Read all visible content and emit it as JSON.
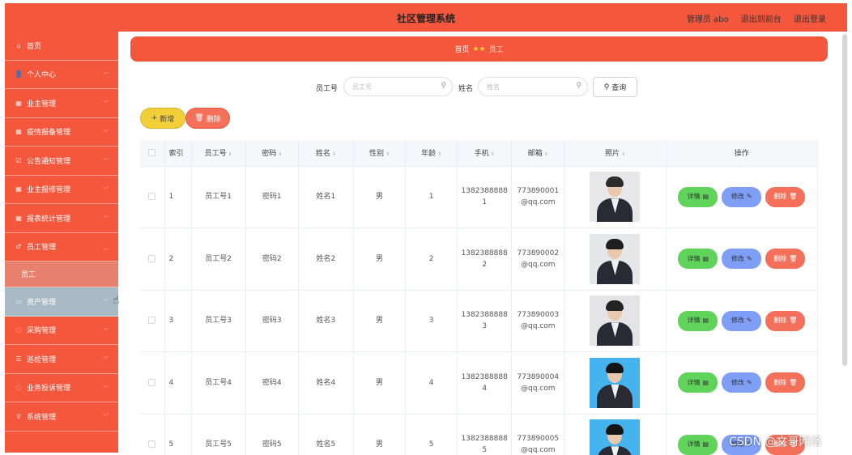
{
  "header": {
    "title": "社区管理系统",
    "user": "管理员 abo",
    "back_link": "退出到前台",
    "logout_link": "退出登录"
  },
  "sidebar": {
    "items": [
      {
        "label": "首页",
        "icon": "⌂",
        "icon_name": "home-icon",
        "has_chevron": false
      },
      {
        "label": "个人中心",
        "icon": "👤",
        "icon_name": "user-icon",
        "has_chevron": true
      },
      {
        "label": "业主管理",
        "icon": "▦",
        "icon_name": "grid-icon",
        "has_chevron": true
      },
      {
        "label": "疫情报备管理",
        "icon": "▦",
        "icon_name": "grid-icon",
        "has_chevron": true
      },
      {
        "label": "公告通知管理",
        "icon": "☑",
        "icon_name": "checkbox-icon",
        "has_chevron": true
      },
      {
        "label": "业主报修管理",
        "icon": "▦",
        "icon_name": "grid-icon",
        "has_chevron": true
      },
      {
        "label": "报表统计管理",
        "icon": "▦",
        "icon_name": "grid-icon",
        "has_chevron": true
      },
      {
        "label": "员工管理",
        "icon": "♂",
        "icon_name": "staff-icon",
        "has_chevron": true,
        "expanded": true
      },
      {
        "label": "员工",
        "icon": "",
        "icon_name": "",
        "has_chevron": false,
        "submenu": true
      },
      {
        "label": "资产管理",
        "icon": "▭",
        "icon_name": "monitor-icon",
        "has_chevron": true,
        "hover": true
      },
      {
        "label": "采购管理",
        "icon": "◌",
        "icon_name": "circle-icon",
        "has_chevron": true
      },
      {
        "label": "巡检管理",
        "icon": "☰",
        "icon_name": "list-icon",
        "has_chevron": true
      },
      {
        "label": "业务投诉管理",
        "icon": "◌",
        "icon_name": "circle-icon",
        "has_chevron": true
      },
      {
        "label": "系统管理",
        "icon": "⚲",
        "icon_name": "pin-icon",
        "has_chevron": true
      }
    ]
  },
  "breadcrumb": {
    "home": "首页",
    "current": "员工"
  },
  "search": {
    "employee_no_label": "员工号",
    "employee_no_placeholder": "员工号",
    "name_label": "姓名",
    "name_placeholder": "姓名",
    "query_button": "查询"
  },
  "actions": {
    "add": "新增",
    "delete": "删除"
  },
  "table": {
    "columns": [
      "索引",
      "员工号",
      "密码",
      "姓名",
      "性别",
      "年龄",
      "手机",
      "邮箱",
      "照片",
      "操作"
    ],
    "row_buttons": {
      "detail": "详情",
      "edit": "修改",
      "remove": "删除"
    },
    "rows": [
      {
        "index": "1",
        "emp_no": "员工号1",
        "password": "密码1",
        "name": "姓名1",
        "gender": "男",
        "age": "1",
        "phone_1": "1382388888",
        "phone_2": "1",
        "email_1": "773890001",
        "email_2": "@qq.com",
        "photo_bg": "#e8e8ea",
        "photo_hair": "#2b2b2b"
      },
      {
        "index": "2",
        "emp_no": "员工号2",
        "password": "密码2",
        "name": "姓名2",
        "gender": "男",
        "age": "2",
        "phone_1": "1382388888",
        "phone_2": "2",
        "email_1": "773890002",
        "email_2": "@qq.com",
        "photo_bg": "#e6e7e9",
        "photo_hair": "#1e1e1e"
      },
      {
        "index": "3",
        "emp_no": "员工号3",
        "password": "密码3",
        "name": "姓名3",
        "gender": "男",
        "age": "3",
        "phone_1": "1382388888",
        "phone_2": "3",
        "email_1": "773890003",
        "email_2": "@qq.com",
        "photo_bg": "#e4e4e6",
        "photo_hair": "#232323"
      },
      {
        "index": "4",
        "emp_no": "员工号4",
        "password": "密码4",
        "name": "姓名4",
        "gender": "男",
        "age": "4",
        "phone_1": "1382388888",
        "phone_2": "4",
        "email_1": "773890004",
        "email_2": "@qq.com",
        "photo_bg": "#45b4ee",
        "photo_hair": "#151515"
      },
      {
        "index": "5",
        "emp_no": "员工号5",
        "password": "密码5",
        "name": "姓名5",
        "gender": "男",
        "age": "5",
        "phone_1": "1382388888",
        "phone_2": "5",
        "email_1": "773890005",
        "email_2": "@qq.com",
        "photo_bg": "#45b4ee",
        "photo_hair": "#151515"
      }
    ]
  },
  "watermark": "CSDN @文哥网络",
  "colors": {
    "primary": "#f5573c",
    "add": "#f2cf38",
    "detail": "#5fd35a",
    "edit": "#7f9ef5",
    "remove": "#f5705a"
  }
}
